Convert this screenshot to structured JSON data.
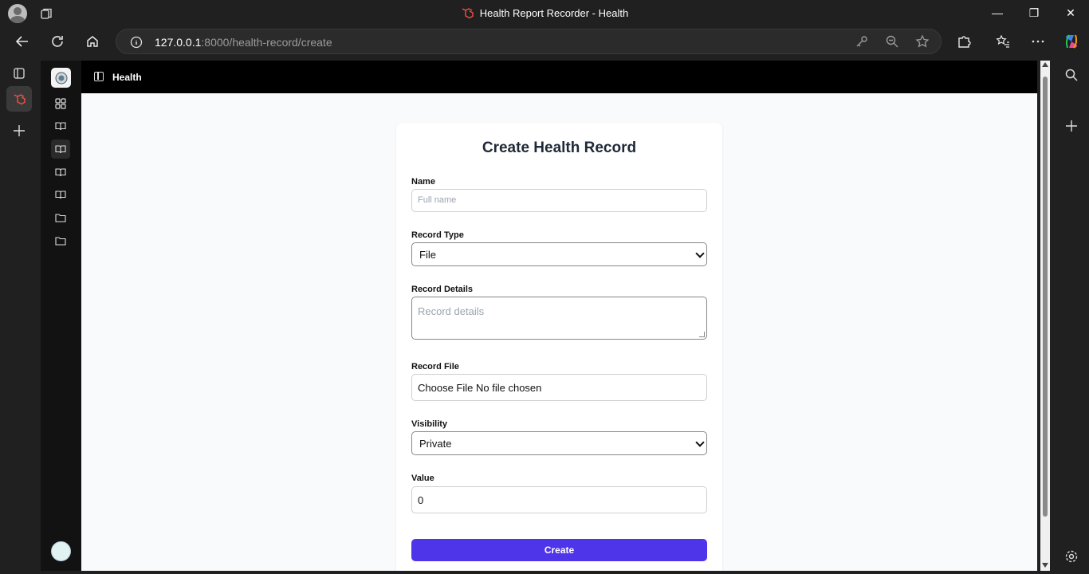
{
  "window": {
    "title": "Health Report Recorder - Health",
    "controls": {
      "minimize": "—",
      "restore": "❐",
      "close": "✕"
    }
  },
  "browser": {
    "url_host": "127.0.0.1",
    "url_path": ":8000/health-record/create"
  },
  "app": {
    "header_title": "Health"
  },
  "form": {
    "title": "Create Health Record",
    "name_label": "Name",
    "name_placeholder": "Full name",
    "record_type_label": "Record Type",
    "record_type_value": "File",
    "record_details_label": "Record Details",
    "record_details_placeholder": "Record details",
    "record_file_label": "Record File",
    "record_file_button": "Choose File",
    "record_file_status": "No file chosen",
    "visibility_label": "Visibility",
    "visibility_value": "Private",
    "value_label": "Value",
    "value_value": "0",
    "submit_label": "Create"
  },
  "colors": {
    "accent": "#4f35ea",
    "header": "#000000",
    "sidebar": "#121212"
  }
}
